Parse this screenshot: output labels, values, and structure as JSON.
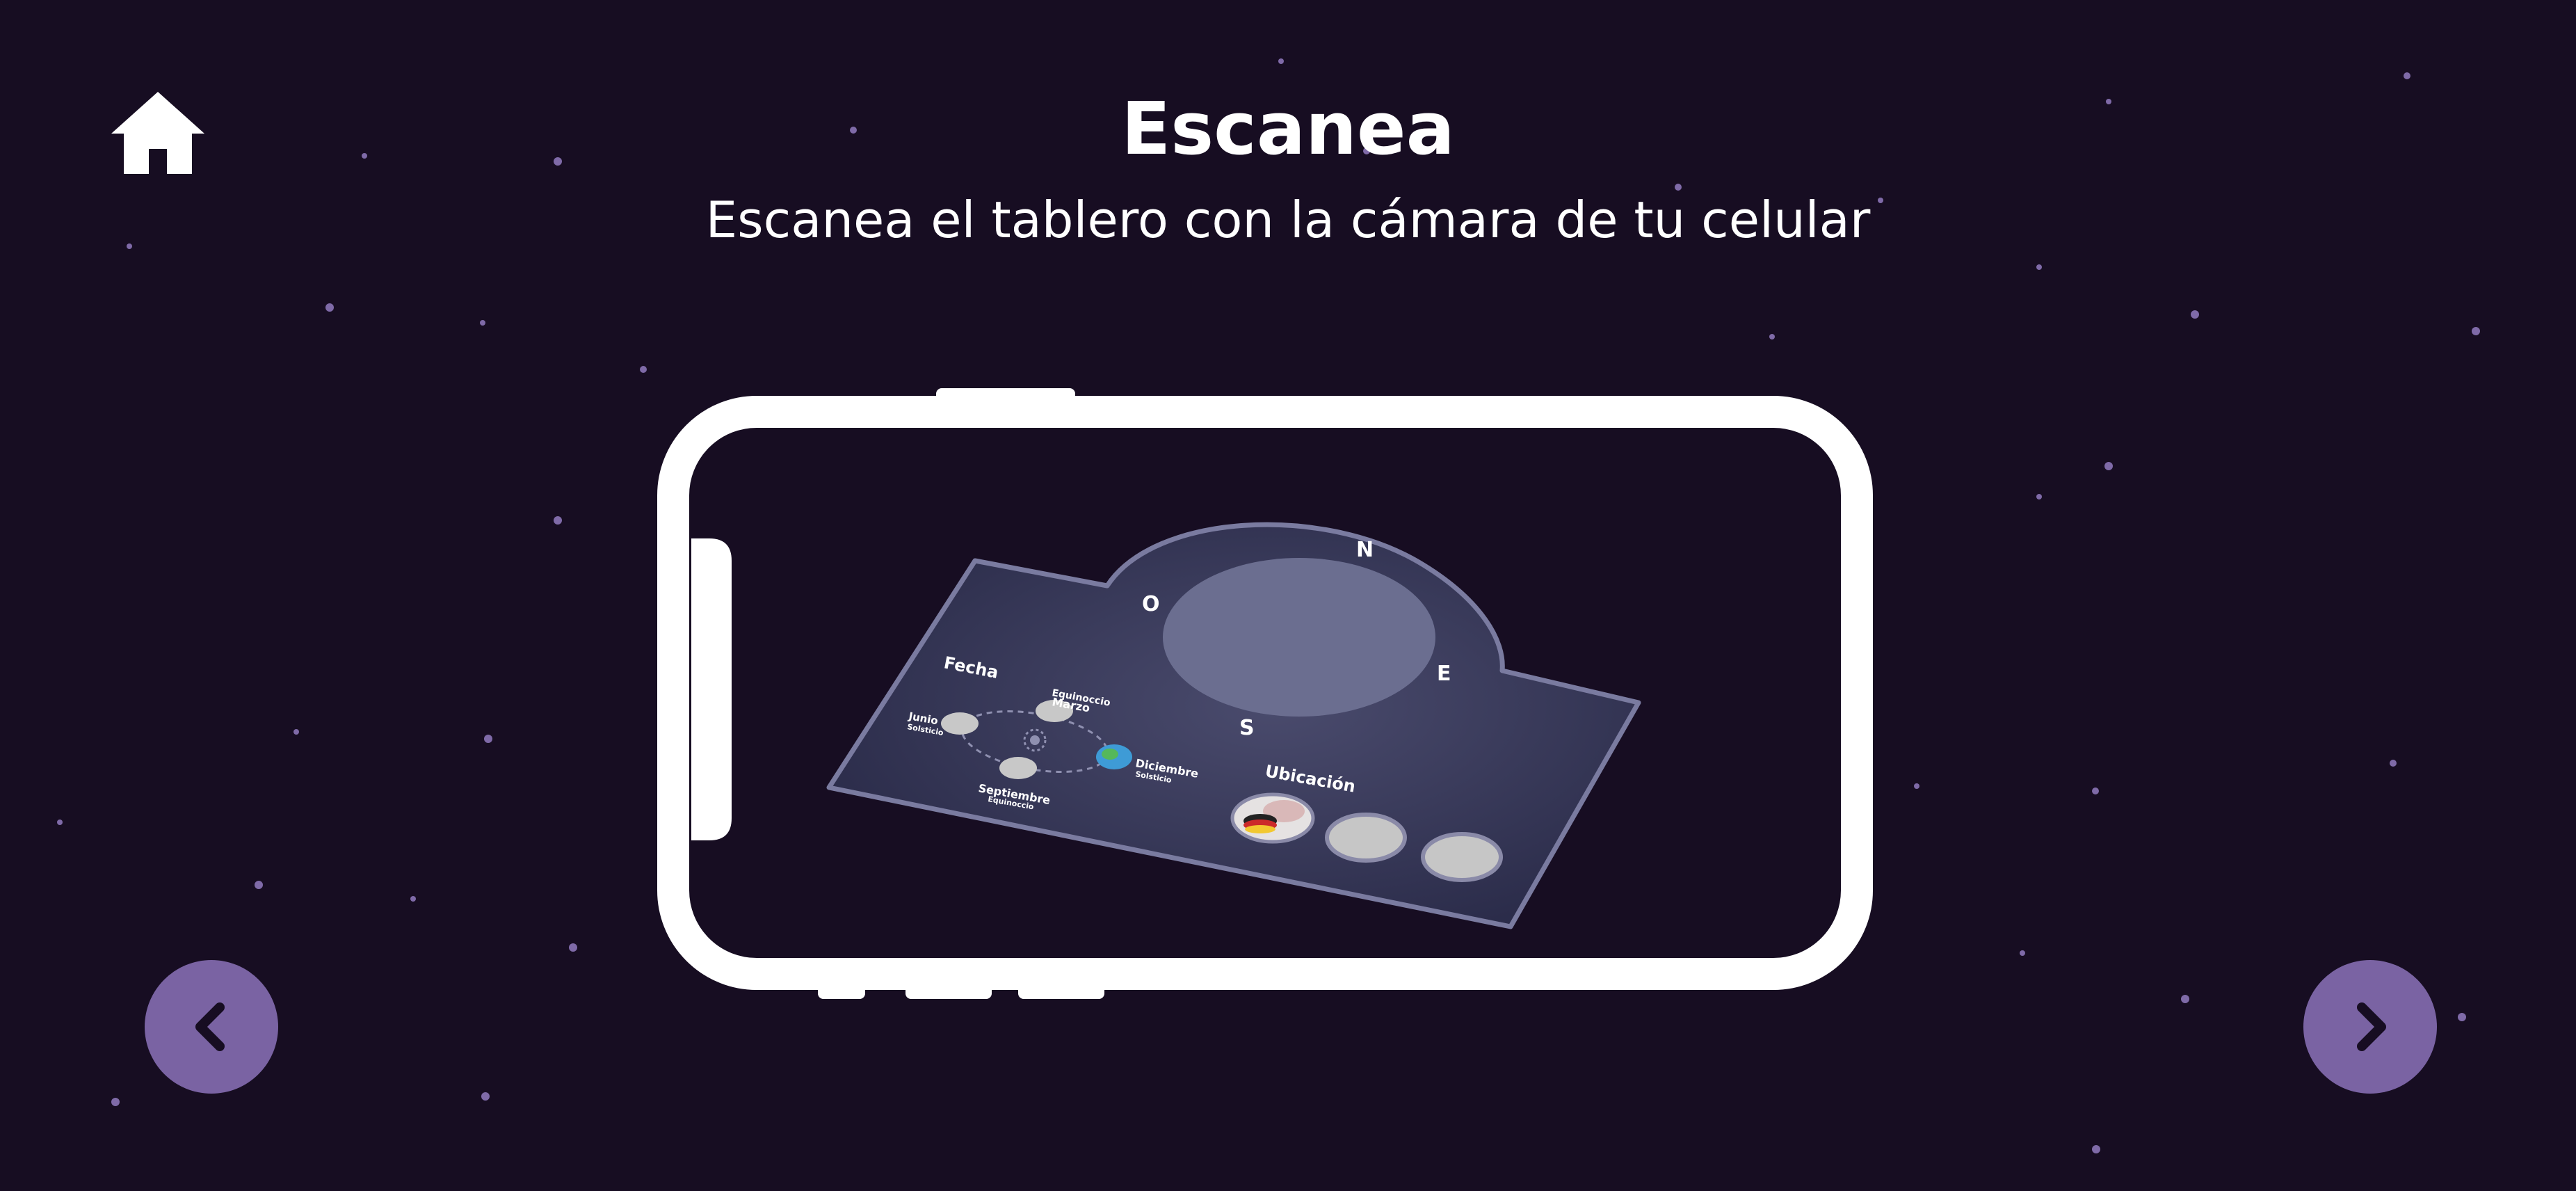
{
  "header": {
    "title": "Escanea",
    "subtitle": "Escanea el tablero con la cámara de tu celular"
  },
  "icons": {
    "home": "home-icon",
    "prev": "chevron-left-icon",
    "next": "chevron-right-icon"
  },
  "board": {
    "fecha_label": "Fecha",
    "ubicacion_label": "Ubicación",
    "compass": {
      "north": "N",
      "east": "E",
      "south": "S",
      "west": "O"
    },
    "months": {
      "marzo": "Marzo",
      "marzo_sub": "Equinoccio",
      "junio": "Junio",
      "junio_sub": "Solsticio",
      "septiembre": "Septiembre",
      "septiembre_sub": "Equinoccio",
      "diciembre": "Diciembre",
      "diciembre_sub": "Solsticio"
    }
  },
  "colors": {
    "background": "#170d22",
    "nav_button": "#7a63a3",
    "phone_frame": "#ffffff",
    "board_fill": "#2c2d4b",
    "board_edge": "#7a7ba0",
    "dial_fill": "#6b6e90"
  }
}
